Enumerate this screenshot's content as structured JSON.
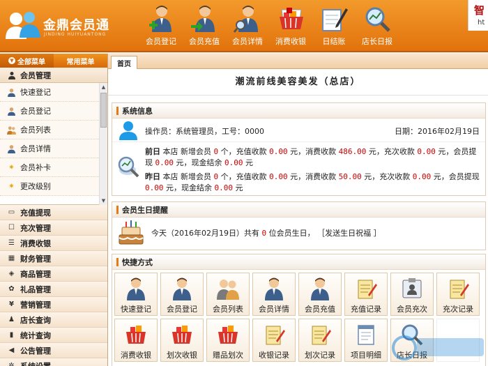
{
  "header": {
    "app_name": "金鼎会员通",
    "app_sub": "JINDING HUIYUANTONG",
    "nav": [
      {
        "label": "会员登记",
        "icon": "person-add-icon"
      },
      {
        "label": "会员充值",
        "icon": "person-recharge-icon"
      },
      {
        "label": "会员详情",
        "icon": "person-search-icon"
      },
      {
        "label": "消费收银",
        "icon": "shopping-basket-icon"
      },
      {
        "label": "日结账",
        "icon": "notepad-pen-icon"
      },
      {
        "label": "店长日报",
        "icon": "magnifier-report-icon"
      }
    ],
    "clip_text_big": "智",
    "clip_text_small": "ht"
  },
  "sidebar": {
    "tab_all": "全部菜单",
    "tab_common": "常用菜单",
    "group": "会员管理",
    "sub_items": [
      "快速登记",
      "会员登记",
      "会员列表",
      "会员详情",
      "会员补卡",
      "更改级别"
    ],
    "main_items": [
      "充值提现",
      "充次管理",
      "消费收银",
      "财务管理",
      "商品管理",
      "礼品管理",
      "营销管理",
      "店长查询",
      "统计查询",
      "公告管理",
      "系统设置"
    ]
  },
  "content": {
    "tab_home": "首页",
    "shop_title": "潮流前线美容美发（总店）",
    "sys": {
      "title": "系统信息",
      "operator_label": "操作员：",
      "operator": "系统管理员",
      "sep": "，",
      "id_label": "工号：",
      "id": "0000",
      "date_label": "日期：",
      "date": "2016年02月19日",
      "prev_day": "前日",
      "yesterday": "昨日",
      "t_store": "本店 新增会员",
      "t_count_unit": "个，充值收款",
      "t_yuan_spend": "元，消费收款",
      "t_yuan_times": "元，充次收款",
      "t_yuan_withdraw": "元，会员提现",
      "t_yuan_cash": "元，现金结余",
      "t_yuan_end": "元",
      "prev": {
        "members": "0",
        "recharge": "0.00",
        "spend": "486.00",
        "times": "0.00",
        "withdraw": "0.00",
        "cash": "0.00"
      },
      "yest": {
        "members": "0",
        "recharge": "0.00",
        "spend": "50.00",
        "times": "0.00",
        "withdraw": "0.00",
        "cash": "0.00"
      }
    },
    "birthday": {
      "title": "会员生日提醒",
      "text_before": "今天（2016年02月19日）共有",
      "count": "0",
      "text_after": "位会员生日，",
      "link": "［发送生日祝福 ］"
    },
    "shortcuts": {
      "title": "快捷方式",
      "items": [
        {
          "label": "快速登记",
          "icon": "person-icon"
        },
        {
          "label": "会员登记",
          "icon": "person-icon"
        },
        {
          "label": "会员列表",
          "icon": "people-icon"
        },
        {
          "label": "会员详情",
          "icon": "person-icon"
        },
        {
          "label": "会员充值",
          "icon": "person-icon"
        },
        {
          "label": "充值记录",
          "icon": "notepad-icon"
        },
        {
          "label": "会员充次",
          "icon": "id-card-icon"
        },
        {
          "label": "充次记录",
          "icon": "notepad-icon"
        },
        {
          "label": "消费收银",
          "icon": "basket-icon"
        },
        {
          "label": "划次收银",
          "icon": "basket-icon"
        },
        {
          "label": "赠品划次",
          "icon": "basket-icon"
        },
        {
          "label": "收银记录",
          "icon": "notepad-icon"
        },
        {
          "label": "划次记录",
          "icon": "notepad-icon"
        },
        {
          "label": "项目明细",
          "icon": "document-icon"
        },
        {
          "label": "店长日报",
          "icon": "magnifier-icon"
        },
        {
          "label": "",
          "icon": "blank"
        }
      ]
    }
  },
  "colors": {
    "accent": "#e67b14",
    "header_orange": "#f39a2c",
    "money_red": "#cc0000"
  }
}
